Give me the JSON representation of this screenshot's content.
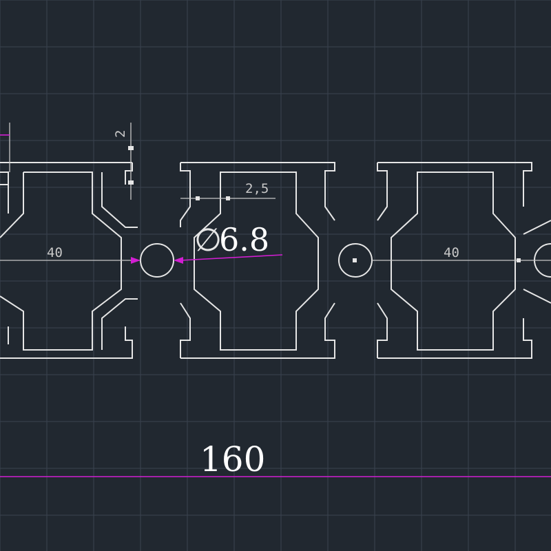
{
  "colors": {
    "background": "#212830",
    "grid": "#3a4350",
    "profile": "#e6e6e6",
    "dimension": "#c8c8c8",
    "accent": "#d21ed2"
  },
  "dimensions": {
    "slot_width_left": "40",
    "slot_width_right": "40",
    "wall_thickness": "2",
    "groove_width": "2,5",
    "hole_diameter": "6.8",
    "total_length": "160"
  },
  "icons": {
    "diameter_symbol": "diameter-icon"
  }
}
